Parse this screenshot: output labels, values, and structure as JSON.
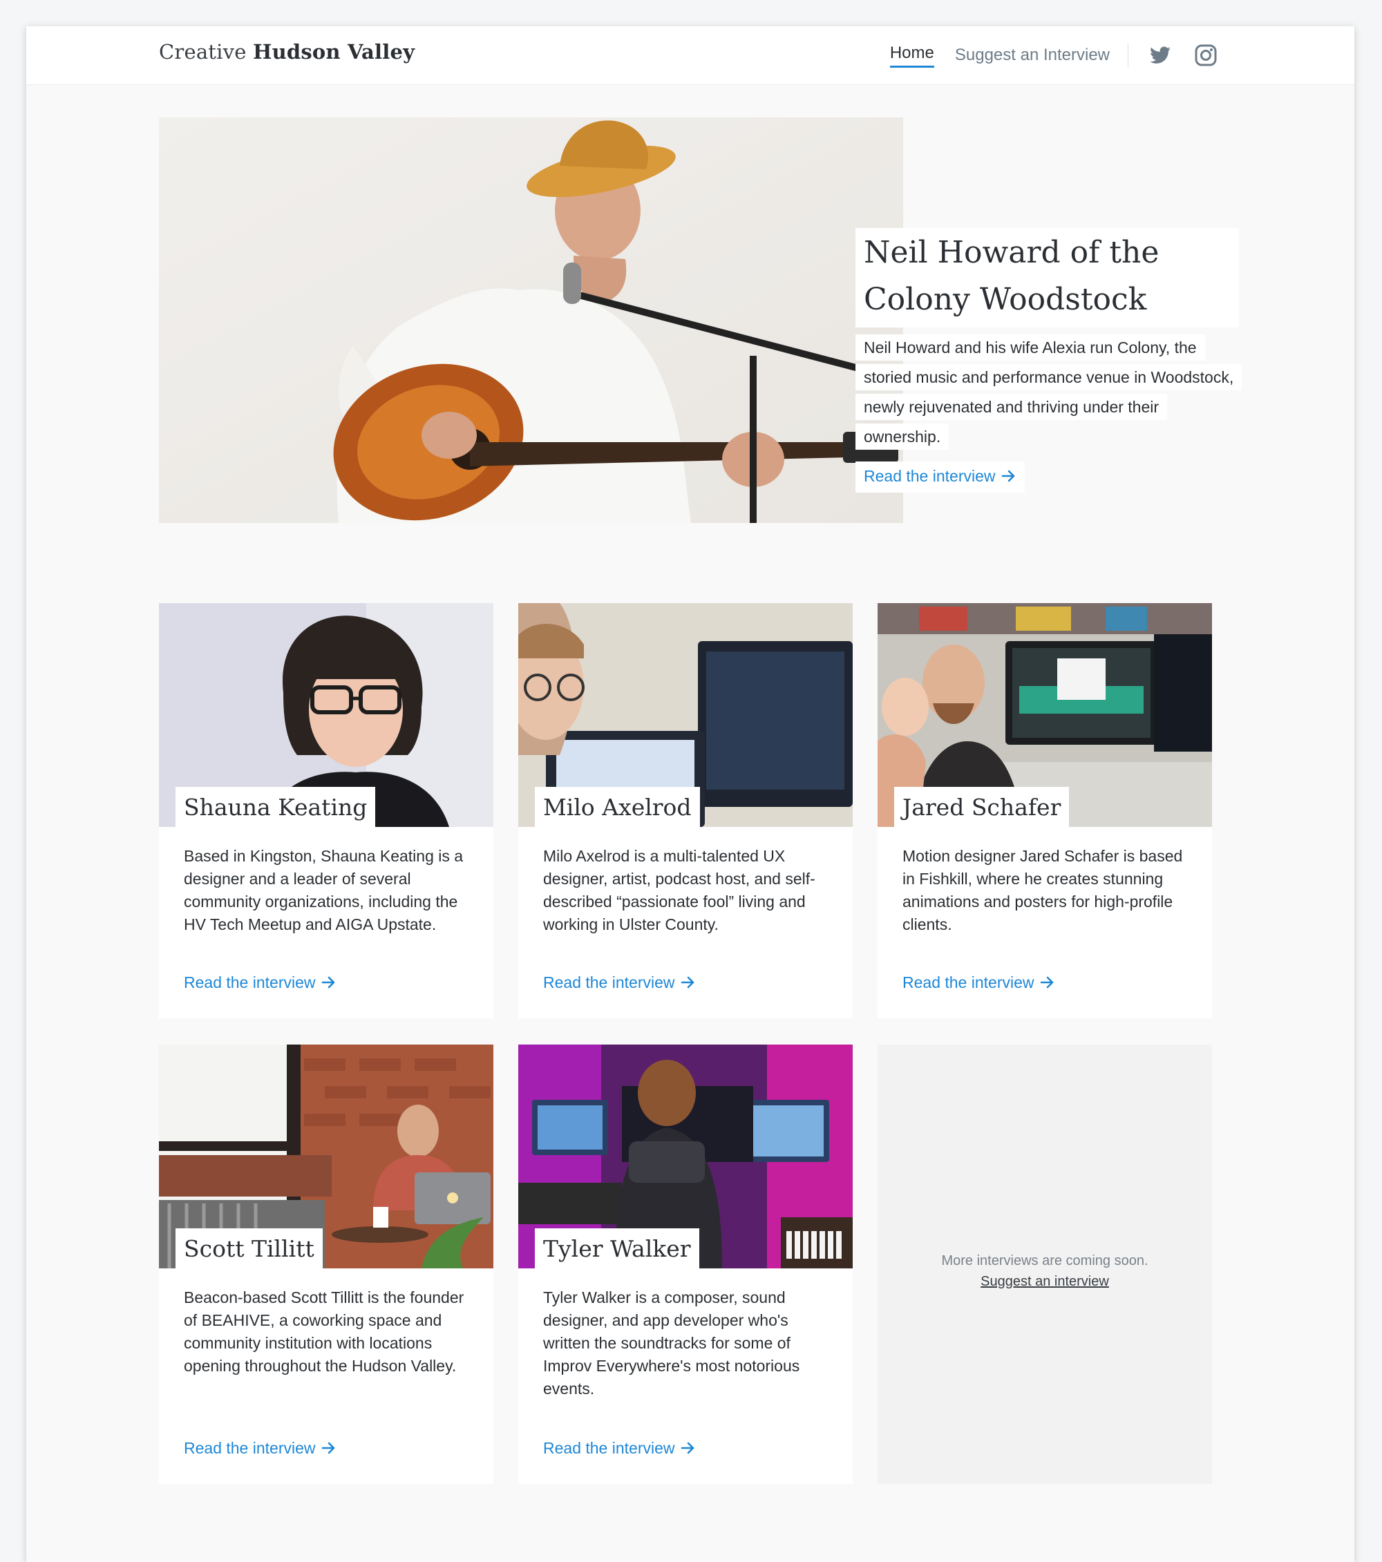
{
  "header": {
    "brand_light": "Creative",
    "brand_bold": "Hudson Valley",
    "nav": {
      "home": "Home",
      "suggest": "Suggest an Interview"
    },
    "social": [
      "twitter-icon",
      "instagram-icon"
    ]
  },
  "hero": {
    "title": "Neil Howard of the Colony Woodstock",
    "description": "Neil Howard and his wife Alexia run Colony, the storied music and performance venue in Woodstock, newly rejuvenated and thriving under their ownership.",
    "link": "Read the interview"
  },
  "cards": [
    {
      "name": "Shauna Keating",
      "description": "Based in Kingston, Shauna Keating is a designer and a leader of several community organizations, including the HV Tech Meetup and AIGA Upstate.",
      "link": "Read the interview"
    },
    {
      "name": "Milo Axelrod",
      "description": "Milo Axelrod is a multi-talented UX designer, artist, podcast host, and self-described “passionate fool” living and working in Ulster County.",
      "link": "Read the interview"
    },
    {
      "name": "Jared Schafer",
      "description": "Motion designer Jared Schafer is based in Fishkill, where he creates stunning animations and posters for high-profile clients.",
      "link": "Read the interview"
    },
    {
      "name": "Scott Tillitt",
      "description": "Beacon-based Scott Tillitt is the founder of BEAHIVE, a coworking space and community institution with locations opening throughout the Hudson Valley.",
      "link": "Read the interview"
    },
    {
      "name": "Tyler Walker",
      "description": "Tyler Walker is a composer, sound designer, and app developer who's written the soundtracks for some of Improv Everywhere's most notorious events.",
      "link": "Read the interview"
    }
  ],
  "coming_soon": {
    "text": "More interviews are coming soon.",
    "link": "Suggest an interview"
  },
  "colors": {
    "link": "#1d87d6",
    "text": "#2b2f33",
    "muted": "#6d7c88"
  }
}
